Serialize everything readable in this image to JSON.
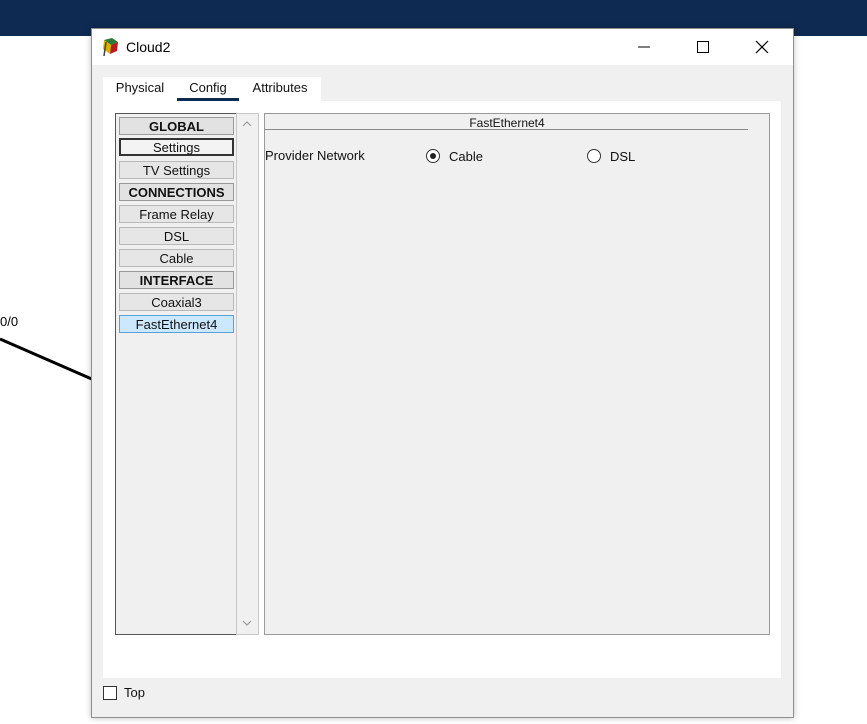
{
  "background": {
    "link_label": "0/0",
    "topbar_color": "#0e2a52"
  },
  "window": {
    "title": "Cloud2",
    "icon": "cloud-device-icon",
    "controls": [
      "minimize-icon",
      "maximize-icon",
      "close-icon"
    ]
  },
  "tabs": [
    {
      "label": "Physical",
      "active": false
    },
    {
      "label": "Config",
      "active": true
    },
    {
      "label": "Attributes",
      "active": false
    }
  ],
  "sidebar": {
    "items": [
      {
        "label": "GLOBAL",
        "type": "header"
      },
      {
        "label": "Settings",
        "type": "item",
        "state": "focused"
      },
      {
        "label": "TV Settings",
        "type": "item"
      },
      {
        "label": "CONNECTIONS",
        "type": "header"
      },
      {
        "label": "Frame Relay",
        "type": "item"
      },
      {
        "label": "DSL",
        "type": "item"
      },
      {
        "label": "Cable",
        "type": "item"
      },
      {
        "label": "INTERFACE",
        "type": "header"
      },
      {
        "label": "Coaxial3",
        "type": "item"
      },
      {
        "label": "FastEthernet4",
        "type": "item",
        "state": "selected"
      }
    ]
  },
  "content": {
    "title": "FastEthernet4",
    "provider_label": "Provider Network",
    "options": [
      {
        "label": "Cable",
        "checked": true
      },
      {
        "label": "DSL",
        "checked": false
      }
    ]
  },
  "footer": {
    "top_label": "Top",
    "top_checked": false
  }
}
